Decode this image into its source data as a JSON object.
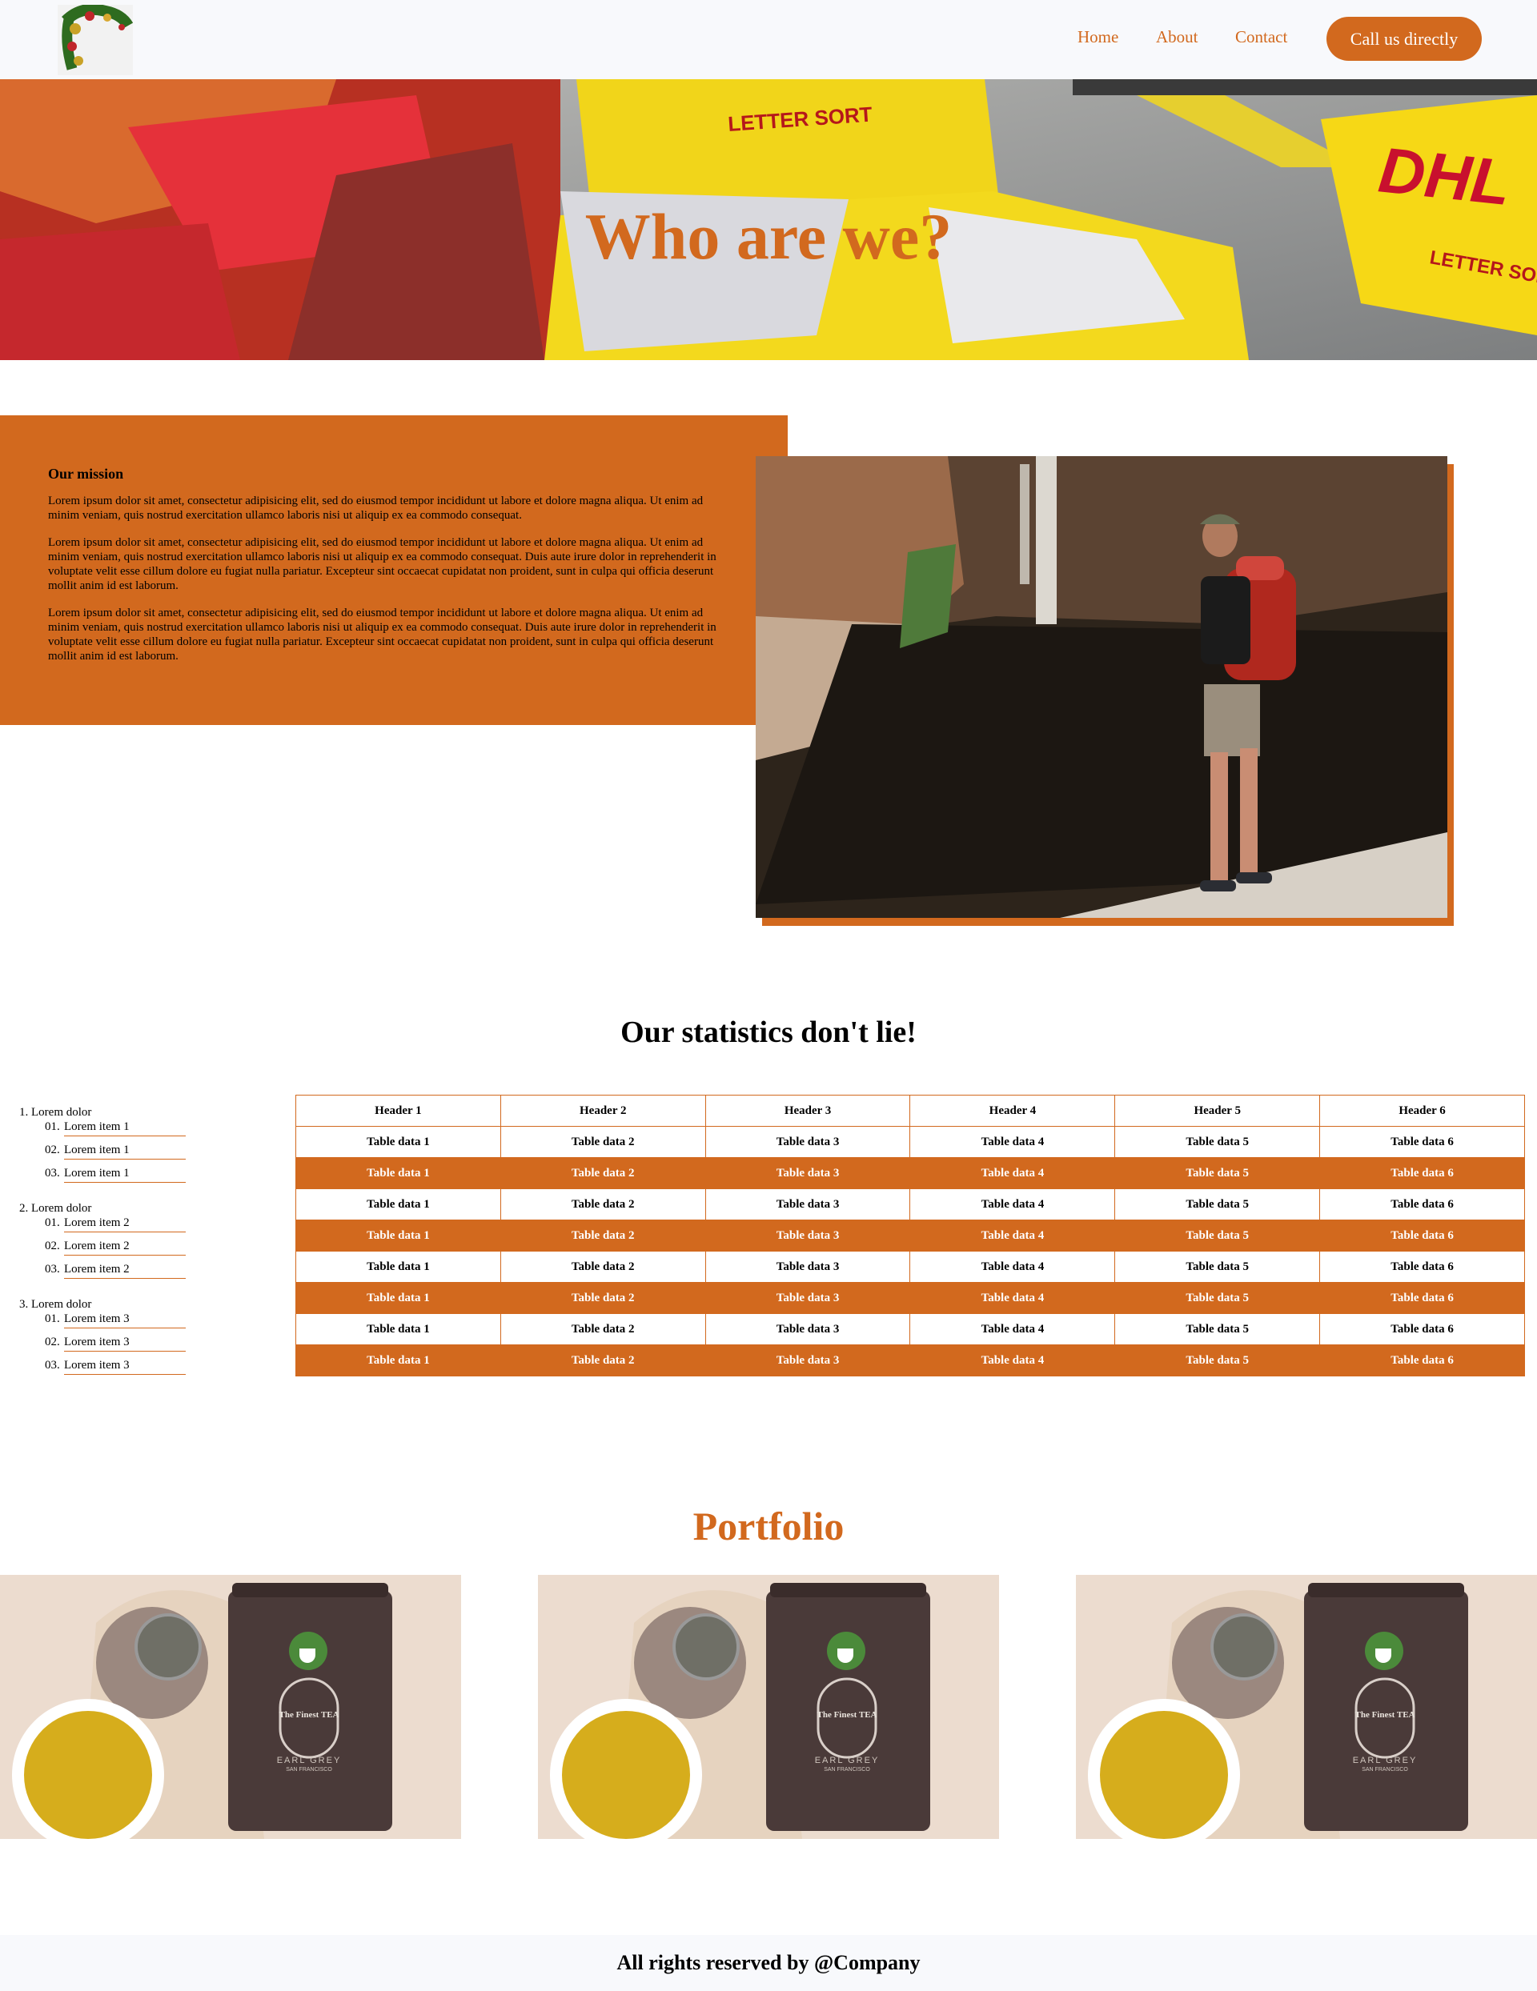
{
  "nav": {
    "links": [
      "Home",
      "About",
      "Contact"
    ],
    "cta": "Call us directly"
  },
  "hero": {
    "title": "Who are we?"
  },
  "mission": {
    "title": "Our mission",
    "paragraphs": [
      "Lorem ipsum dolor sit amet, consectetur adipisicing elit, sed do eiusmod tempor incididunt ut labore et dolore magna aliqua. Ut enim ad minim veniam, quis nostrud exercitation ullamco laboris nisi ut aliquip ex ea commodo consequat.",
      "Lorem ipsum dolor sit amet, consectetur adipisicing elit, sed do eiusmod tempor incididunt ut labore et dolore magna aliqua. Ut enim ad minim veniam, quis nostrud exercitation ullamco laboris nisi ut aliquip ex ea commodo consequat. Duis aute irure dolor in reprehenderit in voluptate velit esse cillum dolore eu fugiat nulla pariatur. Excepteur sint occaecat cupidatat non proident, sunt in culpa qui officia deserunt mollit anim id est laborum.",
      "Lorem ipsum dolor sit amet, consectetur adipisicing elit, sed do eiusmod tempor incididunt ut labore et dolore magna aliqua. Ut enim ad minim veniam, quis nostrud exercitation ullamco laboris nisi ut aliquip ex ea commodo consequat. Duis aute irure dolor in reprehenderit in voluptate velit esse cillum dolore eu fugiat nulla pariatur. Excepteur sint occaecat cupidatat non proident, sunt in culpa qui officia deserunt mollit anim id est laborum."
    ]
  },
  "stats": {
    "title": "Our statistics don't lie!",
    "list": [
      {
        "num": "1.",
        "label": "Lorem dolor",
        "items": [
          {
            "num": "01.",
            "label": "Lorem item 1"
          },
          {
            "num": "02.",
            "label": "Lorem item 1"
          },
          {
            "num": "03.",
            "label": "Lorem item 1"
          }
        ]
      },
      {
        "num": "2.",
        "label": "Lorem dolor",
        "items": [
          {
            "num": "01.",
            "label": "Lorem item 2"
          },
          {
            "num": "02.",
            "label": "Lorem item 2"
          },
          {
            "num": "03.",
            "label": "Lorem item 2"
          }
        ]
      },
      {
        "num": "3.",
        "label": "Lorem dolor",
        "items": [
          {
            "num": "01.",
            "label": "Lorem item 3"
          },
          {
            "num": "02.",
            "label": "Lorem item 3"
          },
          {
            "num": "03.",
            "label": "Lorem item 3"
          }
        ]
      }
    ],
    "table": {
      "headers": [
        "Header 1",
        "Header 2",
        "Header 3",
        "Header 4",
        "Header 5",
        "Header 6"
      ],
      "rows": [
        [
          "Table data 1",
          "Table data 2",
          "Table data 3",
          "Table data 4",
          "Table data 5",
          "Table data 6"
        ],
        [
          "Table data 1",
          "Table data 2",
          "Table data 3",
          "Table data 4",
          "Table data 5",
          "Table data 6"
        ],
        [
          "Table data 1",
          "Table data 2",
          "Table data 3",
          "Table data 4",
          "Table data 5",
          "Table data 6"
        ],
        [
          "Table data 1",
          "Table data 2",
          "Table data 3",
          "Table data 4",
          "Table data 5",
          "Table data 6"
        ],
        [
          "Table data 1",
          "Table data 2",
          "Table data 3",
          "Table data 4",
          "Table data 5",
          "Table data 6"
        ],
        [
          "Table data 1",
          "Table data 2",
          "Table data 3",
          "Table data 4",
          "Table data 5",
          "Table data 6"
        ],
        [
          "Table data 1",
          "Table data 2",
          "Table data 3",
          "Table data 4",
          "Table data 5",
          "Table data 6"
        ],
        [
          "Table data 1",
          "Table data 2",
          "Table data 3",
          "Table data 4",
          "Table data 5",
          "Table data 6"
        ]
      ]
    }
  },
  "portfolio": {
    "title": "Portfolio",
    "items": [
      {
        "brand": "The Finest TEA",
        "city": "SAN FRANCISCO",
        "flavor": "EARL GREY"
      },
      {
        "brand": "The Finest TEA",
        "city": "SAN FRANCISCO",
        "flavor": "EARL GREY"
      },
      {
        "brand": "The Finest TEA",
        "city": "SAN FRANCISCO",
        "flavor": "EARL GREY"
      }
    ]
  },
  "hero_image": {
    "labels": [
      "LETTER SORT",
      "DHL",
      "LETTER SORT"
    ]
  },
  "footer": {
    "text": "All rights reserved by @Company"
  },
  "colors": {
    "accent": "#d2691e",
    "nav_bg": "#f8f9fc"
  }
}
